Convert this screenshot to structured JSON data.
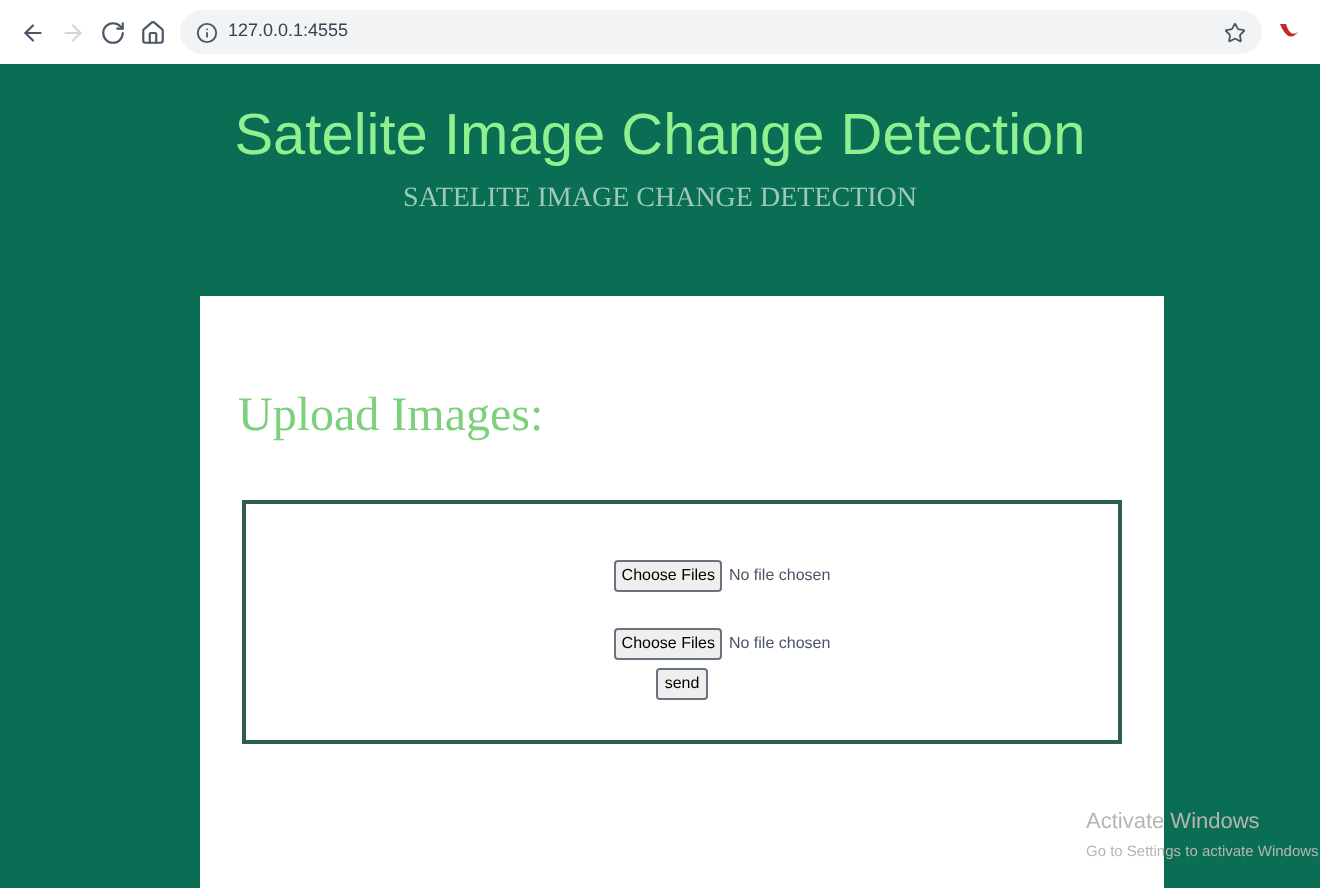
{
  "browser": {
    "url": "127.0.0.1:4555",
    "nav_buttons": [
      {
        "kind": "back",
        "disabled": false
      },
      {
        "kind": "forward",
        "disabled": true
      },
      {
        "kind": "reload",
        "disabled": false
      },
      {
        "kind": "home",
        "disabled": false
      }
    ]
  },
  "header": {
    "title": "Satelite Image Change Detection",
    "subtitle": "SATELITE IMAGE CHANGE DETECTION"
  },
  "card": {
    "heading": "Upload Images:",
    "file_inputs": [
      {
        "button": "Choose Files",
        "status": "No file chosen"
      },
      {
        "button": "Choose Files",
        "status": "No file chosen"
      }
    ],
    "submit": "send"
  },
  "os_notice": {
    "title": "Activate Windows",
    "text": "Go to Settings to activate Windows"
  }
}
